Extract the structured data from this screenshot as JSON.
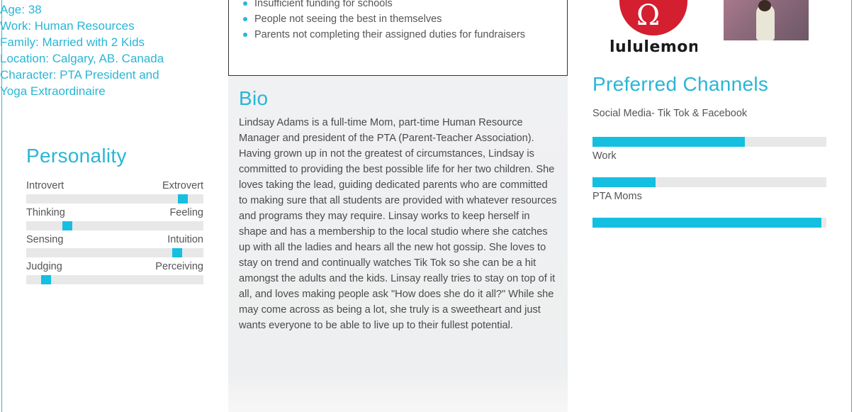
{
  "profile": {
    "info": [
      "Age: 38",
      "Work: Human Resources",
      "Family: Married with 2 Kids",
      "Location: Calgary, AB. Canada",
      "Character: PTA President and",
      "Yoga Extraordinaire"
    ]
  },
  "personality": {
    "title": "Personality",
    "traits": [
      {
        "left": "Introvert",
        "right": "Extrovert",
        "value": 0.885
      },
      {
        "left": "Thinking",
        "right": "Feeling",
        "value": 0.23
      },
      {
        "left": "Sensing",
        "right": "Intuition",
        "value": 0.85
      },
      {
        "left": "Judging",
        "right": "Perceiving",
        "value": 0.11
      }
    ]
  },
  "frustrations": {
    "items": [
      "Insufficient funding for schools",
      "People not seeing the best in themselves",
      "Parents not completing their assigned duties for fundraisers"
    ]
  },
  "bio": {
    "title": "Bio",
    "text": "Lindsay Adams is a full-time Mom, part-time Human Resource Manager and president of the PTA (Parent-Teacher Association). Having grown up in not the greatest of circumstances, Lindsay is committed to providing the best possible life for her two children. She loves taking the lead, guiding dedicated parents who are committed to making sure that all students are provided with whatever resources and programs they may require. Linsay works to keep herself in shape and has a membership to the local studio where she catches up with all the ladies and hears all the new hot gossip. She loves to stay on trend and continually watches Tik Tok so she can be a hit amongst the adults and the kids. Linsay really tries to stay on top of it all, and loves making people ask \"How does she do it all?\"  While she may come across as being a lot, she truly is a sweetheart and just wants everyone to be able to live up to their fullest potential."
  },
  "brands": {
    "logo_word": "lululemon",
    "logo_mark": "Ω"
  },
  "channels": {
    "title": "Preferred Channels",
    "items": [
      {
        "label": "Social Media- Tik Tok & Facebook",
        "value": 0.65
      },
      {
        "label": "Work",
        "value": 0.27
      },
      {
        "label": "PTA Moms",
        "value": 0.98
      }
    ]
  },
  "colors": {
    "accent": "#29b6d6",
    "bar": "#15bfe0",
    "track": "#e8e8e9",
    "logo_red": "#d31f2f"
  }
}
